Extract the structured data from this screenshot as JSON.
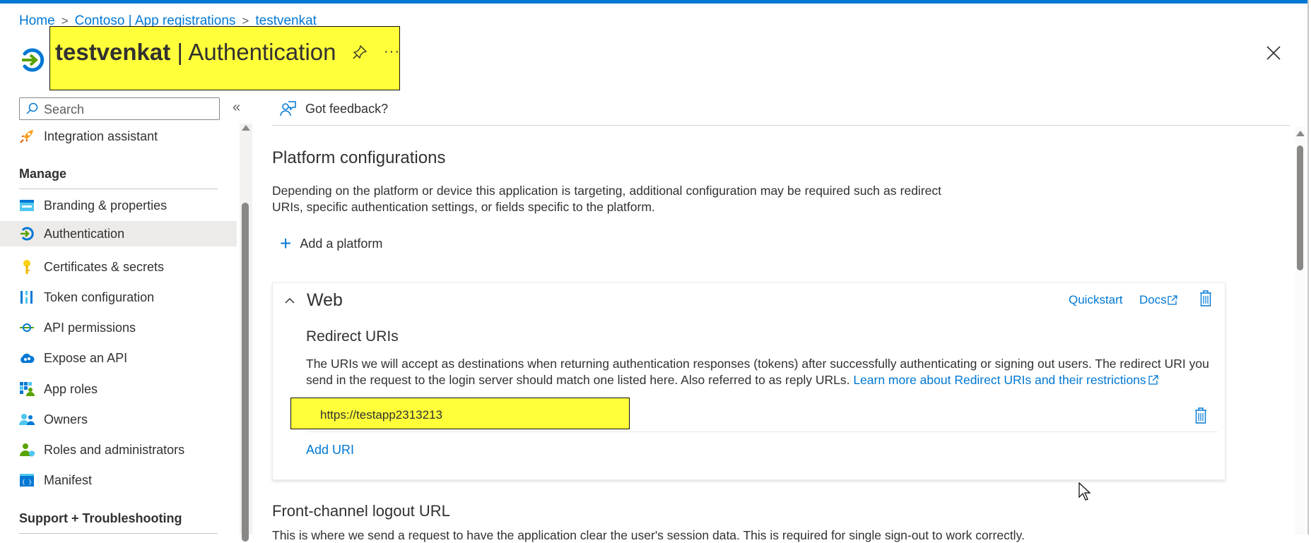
{
  "breadcrumb": {
    "items": [
      "Home",
      "Contoso | App registrations",
      "testvenkat"
    ],
    "separator": ">"
  },
  "header": {
    "app_name": "testvenkat",
    "separator": " | ",
    "page": "Authentication",
    "more": "···"
  },
  "sidebar": {
    "search_placeholder": "Search",
    "collapse": "«",
    "top_item": "Integration assistant",
    "manage_heading": "Manage",
    "items": [
      {
        "label": "Branding & properties",
        "icon": "branding-icon"
      },
      {
        "label": "Authentication",
        "icon": "authentication-icon",
        "active": true
      },
      {
        "label": "Certificates & secrets",
        "icon": "key-icon"
      },
      {
        "label": "Token configuration",
        "icon": "token-icon"
      },
      {
        "label": "API permissions",
        "icon": "api-permissions-icon"
      },
      {
        "label": "Expose an API",
        "icon": "cloud-api-icon"
      },
      {
        "label": "App roles",
        "icon": "app-roles-icon"
      },
      {
        "label": "Owners",
        "icon": "owners-icon"
      },
      {
        "label": "Roles and administrators",
        "icon": "roles-admin-icon"
      },
      {
        "label": "Manifest",
        "icon": "manifest-icon"
      }
    ],
    "support_heading": "Support + Troubleshooting"
  },
  "toolbar": {
    "feedback": "Got feedback?"
  },
  "main": {
    "platform_title": "Platform configurations",
    "platform_desc": "Depending on the platform or device this application is targeting, additional configuration may be required such as redirect URIs, specific authentication settings, or fields specific to the platform.",
    "add_platform": "Add a platform",
    "web": {
      "title": "Web",
      "quickstart": "Quickstart",
      "docs": "Docs",
      "redirect_title": "Redirect URIs",
      "redirect_desc": "The URIs we will accept as destinations when returning authentication responses (tokens) after successfully authenticating or signing out users. The redirect URI you send in the request to the login server should match one listed here. Also referred to as reply URLs. ",
      "redirect_link": "Learn more about Redirect URIs and their restrictions",
      "uris": [
        "https://testapp2313213"
      ],
      "add_uri": "Add URI"
    },
    "logout_title": "Front-channel logout URL",
    "logout_desc": "This is where we send a request to have the application clear the user's session data. This is required for single sign-out to work correctly."
  },
  "colors": {
    "accent": "#0078d4",
    "highlight": "#ffff3a"
  }
}
